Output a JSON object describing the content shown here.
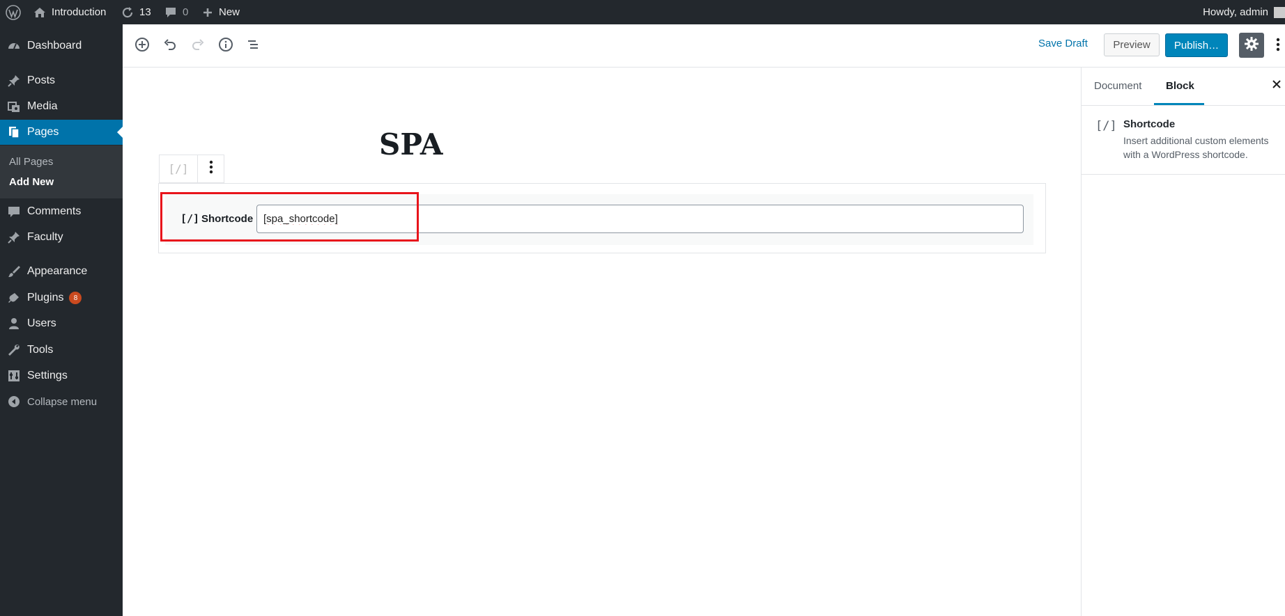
{
  "admin_bar": {
    "site_name": "Introduction",
    "updates_count": "13",
    "comments_count": "0",
    "new_label": "New",
    "greeting": "Howdy, admin"
  },
  "sidebar": {
    "items": [
      {
        "label": "Dashboard",
        "icon": "dashboard-icon"
      },
      {
        "label": "Posts",
        "icon": "pin-icon"
      },
      {
        "label": "Media",
        "icon": "media-icon"
      },
      {
        "label": "Pages",
        "icon": "pages-icon"
      },
      {
        "label": "Comments",
        "icon": "comment-icon"
      },
      {
        "label": "Faculty",
        "icon": "pin-icon"
      },
      {
        "label": "Appearance",
        "icon": "brush-icon"
      },
      {
        "label": "Plugins",
        "icon": "plug-icon",
        "badge": "8"
      },
      {
        "label": "Users",
        "icon": "user-icon"
      },
      {
        "label": "Tools",
        "icon": "wrench-icon"
      },
      {
        "label": "Settings",
        "icon": "settings-icon"
      }
    ],
    "submenu": [
      "All Pages",
      "Add New"
    ],
    "collapse_label": "Collapse menu"
  },
  "toolbar": {
    "save_draft": "Save Draft",
    "preview": "Preview",
    "publish": "Publish…"
  },
  "editor": {
    "title": "SPA",
    "block_icon": "[/]",
    "shortcode_label": "Shortcode",
    "shortcode_value": "[spa_shortcode]"
  },
  "panel": {
    "tab_document": "Document",
    "tab_block": "Block",
    "block_icon": "[/]",
    "block_title": "Shortcode",
    "block_description": "Insert additional custom elements with a WordPress shortcode."
  },
  "colors": {
    "admin_bg": "#23282d",
    "accent": "#0073aa",
    "highlight": "#e8141b"
  }
}
